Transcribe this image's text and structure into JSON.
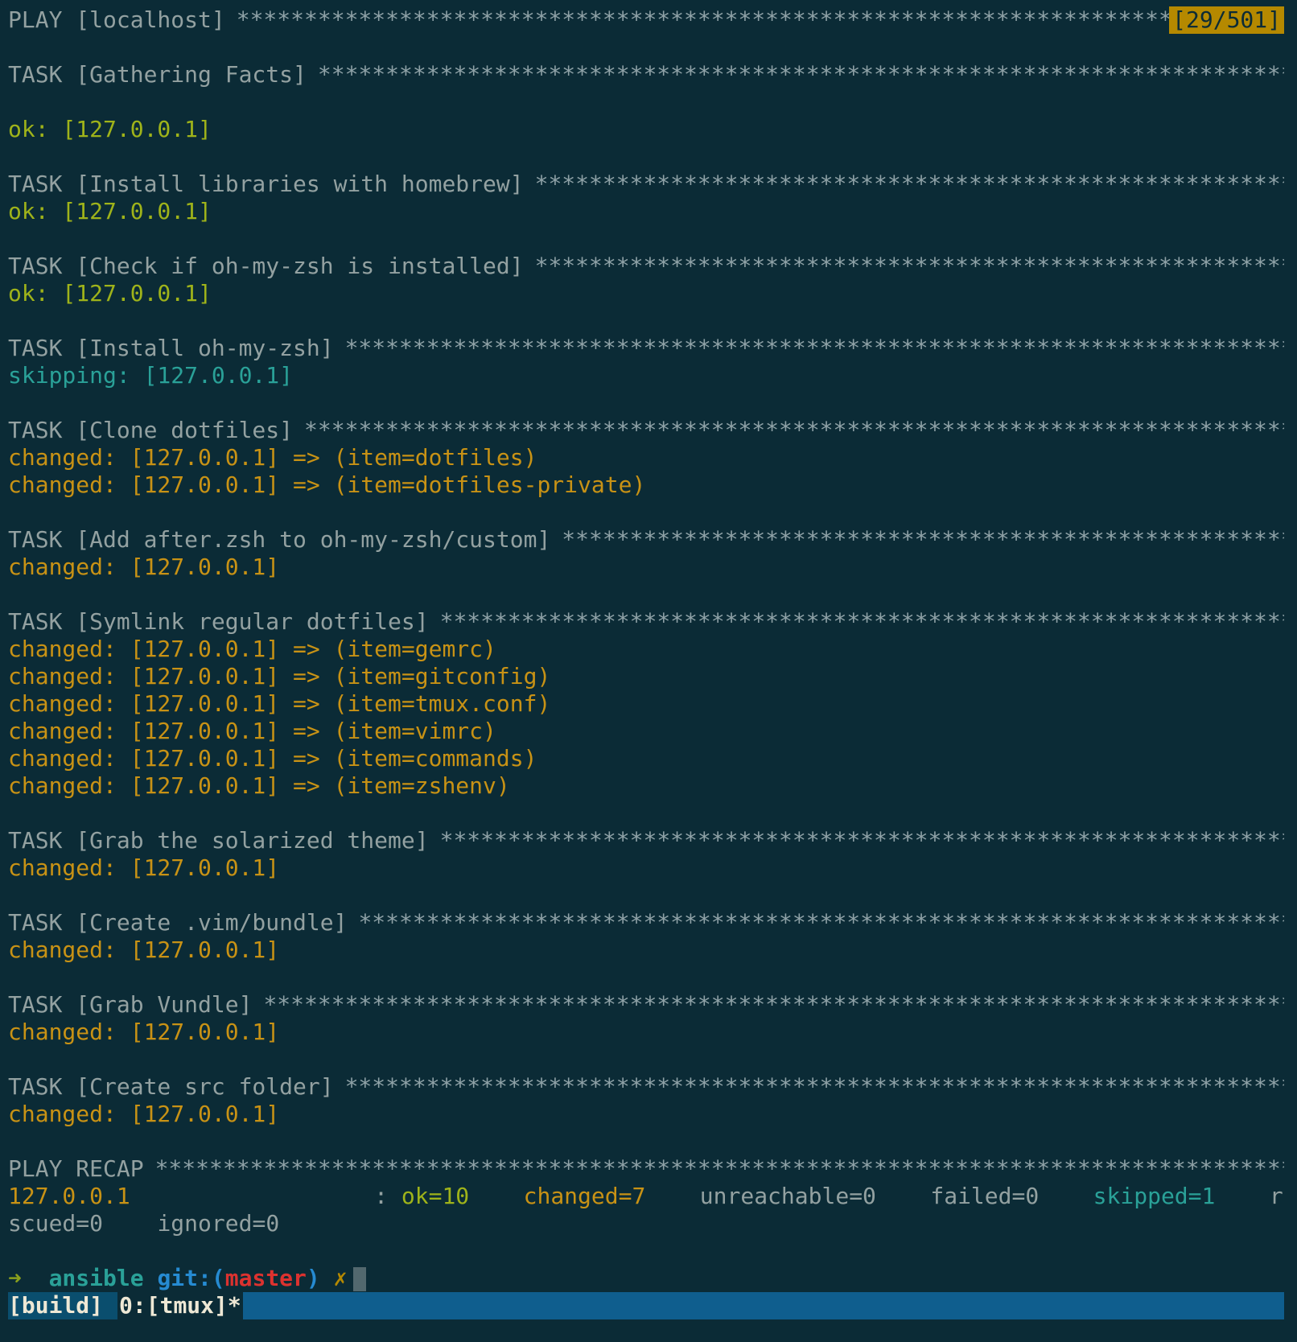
{
  "colors": {
    "background": "#0b2b36",
    "text": "#93a1a1",
    "ok": "#9fb31a",
    "skipping": "#2aa198",
    "changed": "#c89215",
    "status_bar": "#0f5e8e"
  },
  "play": {
    "title": "PLAY [localhost]",
    "counter": "[29/501]"
  },
  "tasks": [
    {
      "title": "TASK [Gathering Facts]",
      "results": [
        "ok: [127.0.0.1]"
      ]
    },
    {
      "title": "TASK [Install libraries with homebrew]",
      "results": [
        "ok: [127.0.0.1]"
      ]
    },
    {
      "title": "TASK [Check if oh-my-zsh is installed]",
      "results": [
        "ok: [127.0.0.1]"
      ]
    },
    {
      "title": "TASK [Install oh-my-zsh]",
      "results": [
        "skipping: [127.0.0.1]"
      ]
    },
    {
      "title": "TASK [Clone dotfiles]",
      "results": [
        "changed: [127.0.0.1] => (item=dotfiles)",
        "changed: [127.0.0.1] => (item=dotfiles-private)"
      ]
    },
    {
      "title": "TASK [Add after.zsh to oh-my-zsh/custom]",
      "results": [
        "changed: [127.0.0.1]"
      ]
    },
    {
      "title": "TASK [Symlink regular dotfiles]",
      "results": [
        "changed: [127.0.0.1] => (item=gemrc)",
        "changed: [127.0.0.1] => (item=gitconfig)",
        "changed: [127.0.0.1] => (item=tmux.conf)",
        "changed: [127.0.0.1] => (item=vimrc)",
        "changed: [127.0.0.1] => (item=commands)",
        "changed: [127.0.0.1] => (item=zshenv)"
      ]
    },
    {
      "title": "TASK [Grab the solarized theme]",
      "results": [
        "changed: [127.0.0.1]"
      ]
    },
    {
      "title": "TASK [Create .vim/bundle]",
      "results": [
        "changed: [127.0.0.1]"
      ]
    },
    {
      "title": "TASK [Grab Vundle]",
      "results": [
        "changed: [127.0.0.1]"
      ]
    },
    {
      "title": "TASK [Create src folder]",
      "results": [
        "changed: [127.0.0.1]"
      ]
    }
  ],
  "recap": {
    "title": "PLAY RECAP",
    "host": "127.0.0.1",
    "colon": ":",
    "ok": "ok=10",
    "changed": "changed=7",
    "unreachable": "unreachable=0",
    "failed": "failed=0",
    "skipped": "skipped=1",
    "rescued_part1": "re",
    "rescued_part2": "scued=0",
    "ignored": "ignored=0"
  },
  "prompt": {
    "arrow": "➜",
    "dir": "ansible",
    "git_label": "git:(",
    "branch": "master",
    "git_close": ")",
    "dirty_mark": "✗"
  },
  "statusbar": {
    "session": "[build]",
    "window": "0:[tmux]*"
  }
}
